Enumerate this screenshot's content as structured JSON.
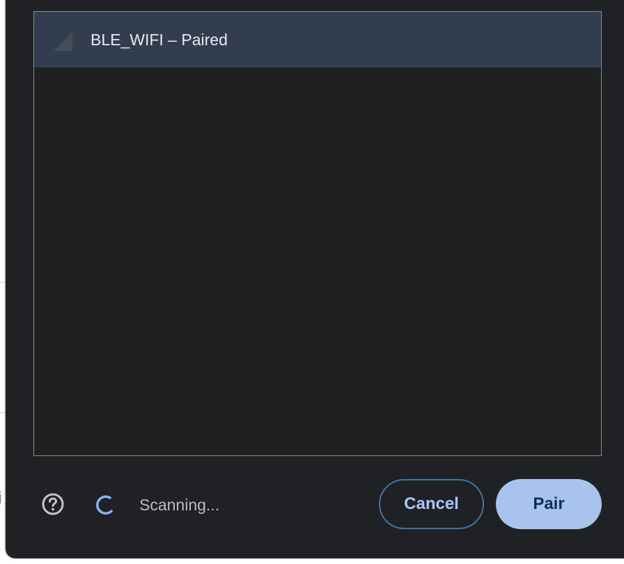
{
  "device_list": {
    "devices": [
      {
        "name": "BLE_WIFI – Paired",
        "icon": "signal-strength-icon",
        "selected": true
      }
    ]
  },
  "footer": {
    "help_icon": "help-circle-icon",
    "spinner_icon": "loading-spinner-icon",
    "status": "Scanning...",
    "cancel_label": "Cancel",
    "pair_label": "Pair"
  },
  "background_text": {
    "edge_glyph": "i"
  },
  "colors": {
    "dialog_bg": "#202124",
    "list_bg": "#202020",
    "selected_row_bg": "#323d4f",
    "accent": "#a8c7fa",
    "primary_button_bg": "#a8c3ee",
    "primary_button_text": "#0e2f5c",
    "status_text": "#b9bcc1"
  }
}
